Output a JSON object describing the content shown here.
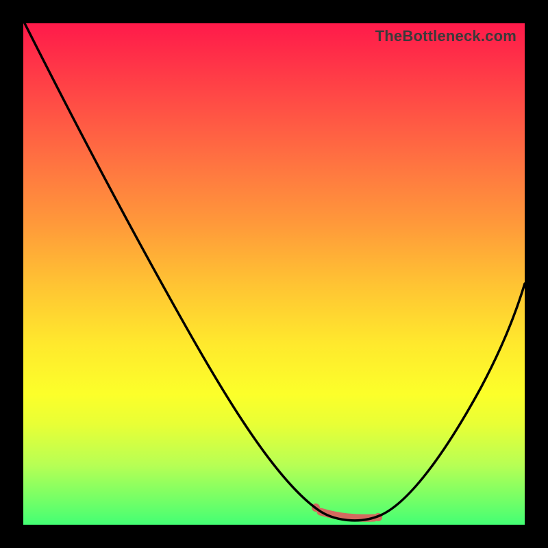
{
  "watermark": "TheBottleneck.com",
  "colors": {
    "frame": "#000000",
    "curve": "#000000",
    "marker": "#d46a5f",
    "gradient_top": "#ff1a4a",
    "gradient_bottom": "#44ff74"
  },
  "chart_data": {
    "type": "line",
    "title": "",
    "xlabel": "",
    "ylabel": "",
    "x": [
      0.0,
      0.05,
      0.1,
      0.15,
      0.2,
      0.25,
      0.3,
      0.35,
      0.4,
      0.45,
      0.5,
      0.55,
      0.6,
      0.62,
      0.65,
      0.68,
      0.7,
      0.75,
      0.8,
      0.85,
      0.9,
      0.95,
      1.0
    ],
    "values": [
      1.0,
      0.9,
      0.8,
      0.7,
      0.6,
      0.51,
      0.43,
      0.35,
      0.27,
      0.19,
      0.12,
      0.06,
      0.02,
      0.01,
      0.0,
      0.0,
      0.01,
      0.05,
      0.12,
      0.21,
      0.31,
      0.42,
      0.54
    ],
    "ylim": [
      0,
      1
    ],
    "xlim": [
      0,
      1
    ],
    "marker_region": {
      "x_start": 0.58,
      "x_end": 0.71,
      "y": 0.01
    },
    "note": "Values are normalized (0=bottom/green, 1=top/red). Curve descends from top-left, reaches minimum near x≈0.65, then rises toward right edge at ~0.54."
  }
}
